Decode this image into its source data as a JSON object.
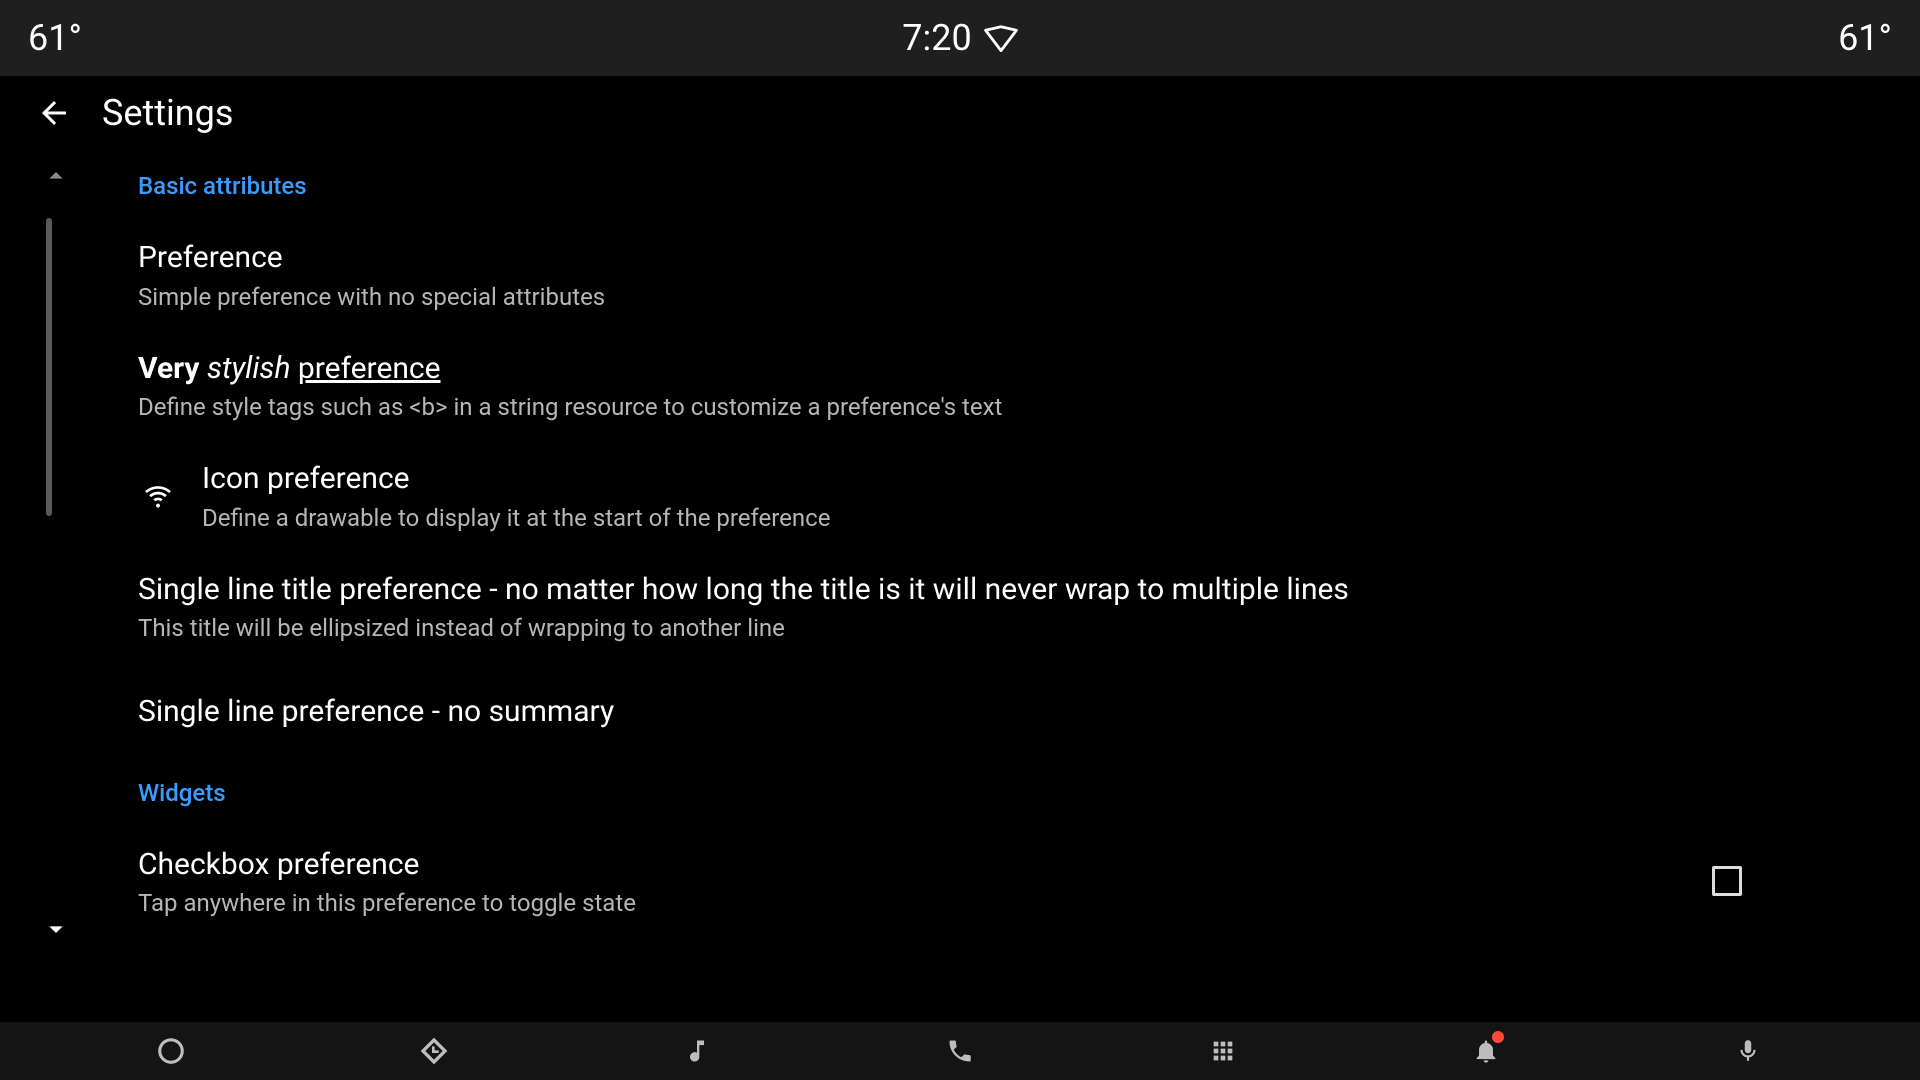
{
  "status": {
    "left_temp": "61°",
    "time": "7:20",
    "right_temp": "61°"
  },
  "header": {
    "title": "Settings"
  },
  "categories": {
    "basic": "Basic attributes",
    "widgets": "Widgets"
  },
  "prefs": {
    "simple": {
      "title": "Preference",
      "summary": "Simple preference with no special attributes"
    },
    "stylish": {
      "title_bold": "Very",
      "title_italic": "stylish",
      "title_underline": "preference",
      "summary": "Define style tags such as <b> in a string resource to customize a preference's text"
    },
    "icon": {
      "title": "Icon preference",
      "summary": "Define a drawable to display it at the start of the preference"
    },
    "singleline": {
      "title": "Single line title preference - no matter how long the title is it will never wrap to multiple lines",
      "summary": "This title will be ellipsized instead of wrapping to another line"
    },
    "nosummary": {
      "title": "Single line preference - no summary"
    },
    "checkbox": {
      "title": "Checkbox preference",
      "summary": "Tap anywhere in this preference to toggle state",
      "checked": false
    }
  }
}
